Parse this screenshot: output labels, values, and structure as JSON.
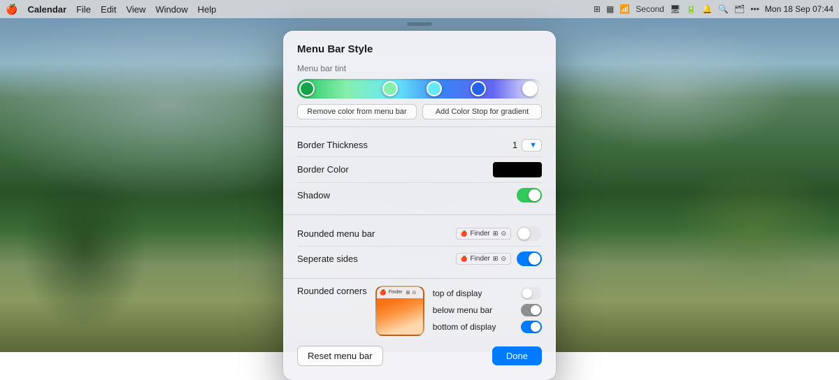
{
  "menubar": {
    "apple": "🍎",
    "app": "Calendar",
    "items": [
      "File",
      "Edit",
      "View",
      "Window",
      "Help"
    ],
    "right_items": [
      "⊞",
      "▦",
      "wifi",
      "Second",
      "🖥",
      "🔋",
      "🔔",
      "🔍",
      "dropbox",
      "•••",
      "⊟"
    ],
    "time": "Mon 18 Sep 07:44"
  },
  "dialog": {
    "title": "Menu Bar Style",
    "gradient_section_label": "Menu bar tint",
    "btn_remove_color": "Remove color from menu bar",
    "btn_add_stop": "Add Color Stop for gradient",
    "border_thickness_label": "Border Thickness",
    "border_thickness_value": "1",
    "border_color_label": "Border Color",
    "shadow_label": "Shadow",
    "rounded_menubar_label": "Rounded menu bar",
    "separate_sides_label": "Seperate sides",
    "rounded_corners_label": "Rounded corners",
    "top_of_display": "top of display",
    "below_menu_bar": "below menu bar",
    "bottom_of_display": "bottom of display",
    "btn_reset": "Reset menu bar",
    "btn_done": "Done"
  }
}
